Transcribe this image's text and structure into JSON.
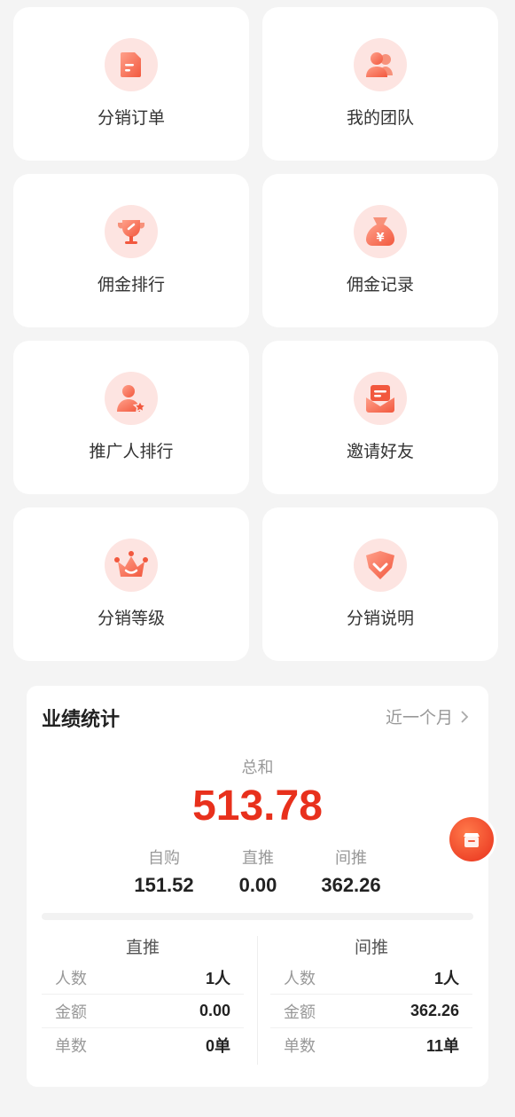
{
  "menu": [
    {
      "label": "分销订单",
      "icon": "order-icon"
    },
    {
      "label": "我的团队",
      "icon": "team-icon"
    },
    {
      "label": "佣金排行",
      "icon": "trophy-icon"
    },
    {
      "label": "佣金记录",
      "icon": "money-bag-icon"
    },
    {
      "label": "推广人排行",
      "icon": "promoter-icon"
    },
    {
      "label": "邀请好友",
      "icon": "invite-envelope-icon"
    },
    {
      "label": "分销等级",
      "icon": "crown-icon"
    },
    {
      "label": "分销说明",
      "icon": "shield-chevron-icon"
    }
  ],
  "stats": {
    "title": "业绩统计",
    "period": "近一个月",
    "total_label": "总和",
    "total_value": "513.78",
    "self_label": "自购",
    "self_value": "151.52",
    "direct_label": "直推",
    "direct_value": "0.00",
    "indirect_label": "间推",
    "indirect_value": "362.26"
  },
  "direct": {
    "title": "直推",
    "rows": [
      {
        "k": "人数",
        "v": "1人"
      },
      {
        "k": "金额",
        "v": "0.00"
      },
      {
        "k": "单数",
        "v": "0单"
      }
    ]
  },
  "indirect": {
    "title": "间推",
    "rows": [
      {
        "k": "人数",
        "v": "1人"
      },
      {
        "k": "金额",
        "v": "362.26"
      },
      {
        "k": "单数",
        "v": "11单"
      }
    ]
  },
  "colors": {
    "accent": "#e8301c",
    "icon_bg": "#fde4e1",
    "icon_fg": "#f26a4e"
  },
  "fab_icon": "shop-icon"
}
